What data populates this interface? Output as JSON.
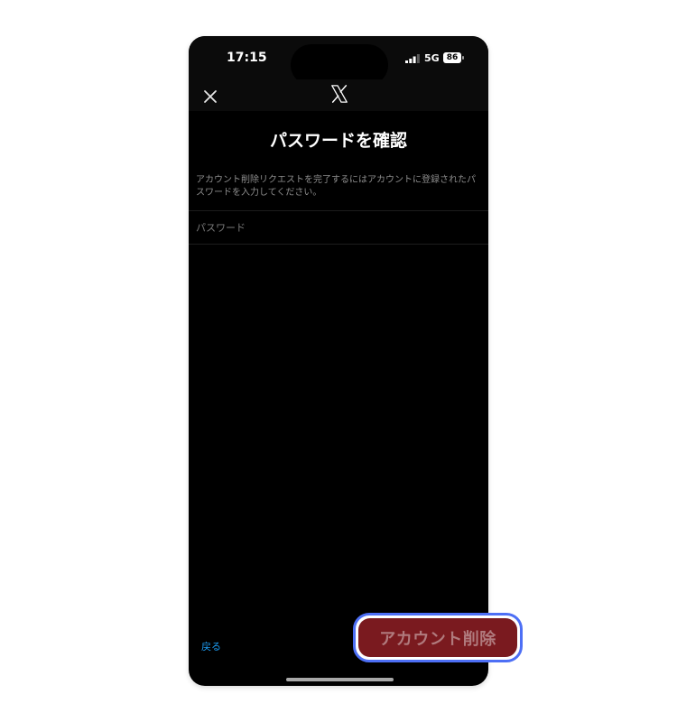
{
  "status_bar": {
    "time": "17:15",
    "network": "5G",
    "battery": "86"
  },
  "nav": {
    "close_icon": "close-icon",
    "logo_icon": "x-logo-icon"
  },
  "main": {
    "title": "パスワードを確認",
    "description": "アカウント削除リクエストを完了するにはアカウントに登録されたパスワードを入力してください。",
    "password_placeholder": "パスワード",
    "password_value": ""
  },
  "footer": {
    "back_label": "戻る",
    "delete_label": "アカウント削除"
  },
  "colors": {
    "background": "#000000",
    "link": "#1d9bf0",
    "delete_bg": "#7a1a1f",
    "highlight": "#4d6ff5"
  }
}
